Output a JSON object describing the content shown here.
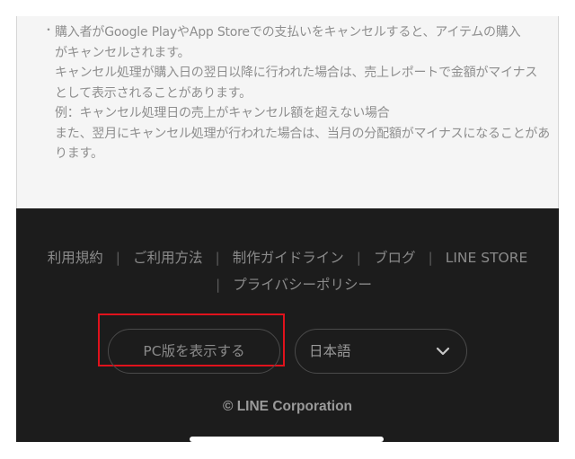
{
  "notice": {
    "bullet": "・",
    "lines": [
      "購入者がGoogle PlayやApp Storeでの支払いをキャンセルすると、アイテムの購入",
      "がキャンセルされます。",
      "キャンセル処理が購入日の翌日以降に行われた場合は、売上レポートで金額がマイナス",
      "として表示されることがあります。",
      "例：キャンセル処理日の売上がキャンセル額を超えない場合",
      "また、翌月にキャンセル処理が行われた場合は、当月の分配額がマイナスになることがあ",
      "ります。"
    ]
  },
  "footer": {
    "links": [
      "利用規約",
      "ご利用方法",
      "制作ガイドライン",
      "ブログ",
      "LINE STORE",
      "プライバシーポリシー"
    ],
    "separator": "|",
    "pc_button_label": "PC版を表示する",
    "language_selected": "日本語",
    "copyright": "© LINE Corporation",
    "colors": {
      "background": "#1c1c1c",
      "text": "#8a8a8a",
      "highlight": "#e0121c"
    }
  }
}
